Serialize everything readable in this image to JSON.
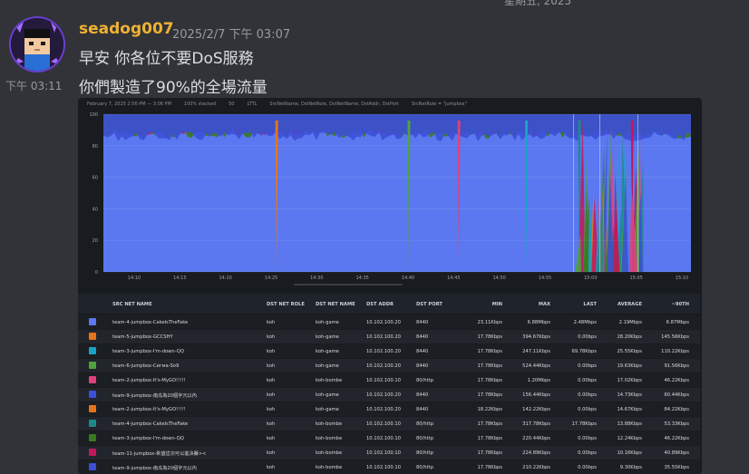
{
  "top_clip": "星期五, 2025",
  "author": "seadog007",
  "timestamp": "2025/2/7 下午 03:07",
  "messages": [
    "早安 你各位不要DoS服務",
    "你們製造了90%的全場流量"
  ],
  "side_time": "下午 03:11",
  "panel": {
    "toolbar": [
      "February 7, 2025 2:56 PM — 3:06 PM",
      "100% stacked",
      "50",
      "LTTL",
      "SrcNetName, DstNetRole, DstNetName, DstAddr, DstPort",
      "SrcNetRole = \"jumpbox\""
    ],
    "colors": {
      "blue": "#5b78f0",
      "orange": "#e8741a",
      "cyan": "#1aa3c8",
      "green": "#4fa33b",
      "pink": "#e0417a",
      "indigo": "#3c4fd8",
      "teal": "#1d8a8a",
      "olive": "#3a7a1e",
      "magenta": "#c2185b"
    }
  },
  "chart_data": {
    "type": "area",
    "title": "",
    "xlabel": "",
    "ylabel": "",
    "ylim": [
      0,
      100
    ],
    "y_ticks": [
      "100",
      "80",
      "60",
      "40",
      "20",
      "0"
    ],
    "x_ticks": [
      "14:10",
      "14:15",
      "14:20",
      "14:25",
      "14:30",
      "14:35",
      "14:40",
      "14:45",
      "14:50",
      "14:55",
      "15:00",
      "15:05",
      "15:10"
    ],
    "grid": true,
    "legend": "table-bottom",
    "series_note": "100% stacked; blue series dominates (~85-95%)"
  },
  "table": {
    "headers": [
      "SRC NET NAME",
      "DST NET ROLE",
      "DST NET NAME",
      "DST ADDR",
      "DST PORT",
      "MIN",
      "MAX",
      "LAST",
      "AVERAGE",
      "~90TH"
    ],
    "rows": [
      {
        "color": "#5b78f0",
        "name": "team-4-jumpbox-CakeIsTheFake",
        "role": "koh",
        "dst": "koh-game",
        "addr": "10.102.100.20",
        "port": "8440",
        "min": "23.11Kbps",
        "max": "6.88Mbps",
        "last": "2.48Mbps",
        "avg": "2.19Mbps",
        "p90": "6.87Mbps"
      },
      {
        "color": "#e8741a",
        "name": "team-5-jumpbox-GCCSHY",
        "role": "koh",
        "dst": "koh-game",
        "addr": "10.102.100.20",
        "port": "8440",
        "min": "17.78Kbps",
        "max": "394.67Kbps",
        "last": "0.00bps",
        "avg": "28.20Kbps",
        "p90": "145.56Kbps"
      },
      {
        "color": "#1aa3c8",
        "name": "team-3-jumpbox-I'm-down-QQ",
        "role": "koh",
        "dst": "koh-game",
        "addr": "10.102.100.20",
        "port": "8440",
        "min": "17.78Kbps",
        "max": "247.11Kbps",
        "last": "69.78Kbps",
        "avg": "25.55Kbps",
        "p90": "110.22Kbps"
      },
      {
        "color": "#4fa33b",
        "name": "team-6-jumpbox-Cигма-Sо9",
        "role": "koh",
        "dst": "koh-game",
        "addr": "10.102.100.20",
        "port": "8440",
        "min": "17.78Kbps",
        "max": "524.44Kbps",
        "last": "0.00bps",
        "avg": "19.63Kbps",
        "p90": "91.56Kbps"
      },
      {
        "color": "#e0417a",
        "name": "team-2-jumpbox-It's-MyGO!!!!!",
        "role": "koh",
        "dst": "koh-bombe",
        "addr": "10.102.100.10",
        "port": "80/http",
        "min": "17.78Kbps",
        "max": "1.20Mbps",
        "last": "0.00bps",
        "avg": "17.02Kbps",
        "p90": "46.22Kbps"
      },
      {
        "color": "#3c4fd8",
        "name": "team-9-jumpbox-南瓜為20個字元以內",
        "role": "koh",
        "dst": "koh-game",
        "addr": "10.102.100.20",
        "port": "8440",
        "min": "17.78Kbps",
        "max": "156.44Kbps",
        "last": "0.00bps",
        "avg": "14.73Kbps",
        "p90": "60.44Kbps"
      },
      {
        "color": "#e8741a",
        "name": "team-2-jumpbox-It's-MyGO!!!!!",
        "role": "koh",
        "dst": "koh-game",
        "addr": "10.102.100.20",
        "port": "8440",
        "min": "18.22Kbps",
        "max": "142.22Kbps",
        "last": "0.00bps",
        "avg": "14.67Kbps",
        "p90": "84.22Kbps"
      },
      {
        "color": "#1d8a8a",
        "name": "team-4-jumpbox-CakeIsTheFake",
        "role": "koh",
        "dst": "koh-bombe",
        "addr": "10.102.100.10",
        "port": "80/http",
        "min": "17.78Kbps",
        "max": "317.78Kbps",
        "last": "17.78Kbps",
        "avg": "13.88Kbps",
        "p90": "53.33Kbps"
      },
      {
        "color": "#3a7a1e",
        "name": "team-3-jumpbox-I'm-down-QQ",
        "role": "koh",
        "dst": "koh-bombe",
        "addr": "10.102.100.10",
        "port": "80/http",
        "min": "17.78Kbps",
        "max": "220.44Kbps",
        "last": "0.00bps",
        "avg": "12.24Kbps",
        "p90": "46.22Kbps"
      },
      {
        "color": "#c2185b",
        "name": "team-11-jumpbox-希望這次可以進決賽><",
        "role": "koh",
        "dst": "koh-bombe",
        "addr": "10.102.100.10",
        "port": "80/http",
        "min": "17.78Kbps",
        "max": "224.89Kbps",
        "last": "0.00bps",
        "avg": "10.16Kbps",
        "p90": "40.89Kbps"
      },
      {
        "color": "#3c4fd8",
        "name": "team-9-jumpbox-南瓜為20個字元以內",
        "role": "koh",
        "dst": "koh-bombe",
        "addr": "10.102.100.10",
        "port": "80/http",
        "min": "17.78Kbps",
        "max": "210.22Kbps",
        "last": "0.00bps",
        "avg": "9.30Kbps",
        "p90": "35.55Kbps"
      }
    ]
  }
}
